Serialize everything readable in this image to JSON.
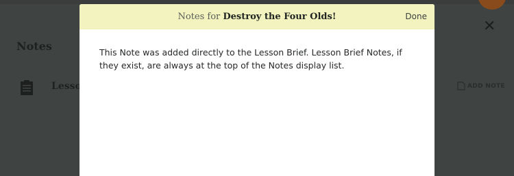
{
  "background": {
    "section_title": "Notes",
    "lesson_label": "Lesso",
    "add_note_label": "ADD NOTE",
    "close_symbol": "✕"
  },
  "modal": {
    "title_prefix": "Notes for",
    "lesson_name": "Destroy the Four Olds!",
    "done_label": "Done",
    "note_text": "This Note was added directly to the Lesson Brief.  Lesson Brief Notes, if they exist, are always at the top of the Notes display list."
  },
  "colors": {
    "overlay": "#3f4342",
    "modal_header": "#f2f3be",
    "avatar": "#8a4b1c"
  }
}
